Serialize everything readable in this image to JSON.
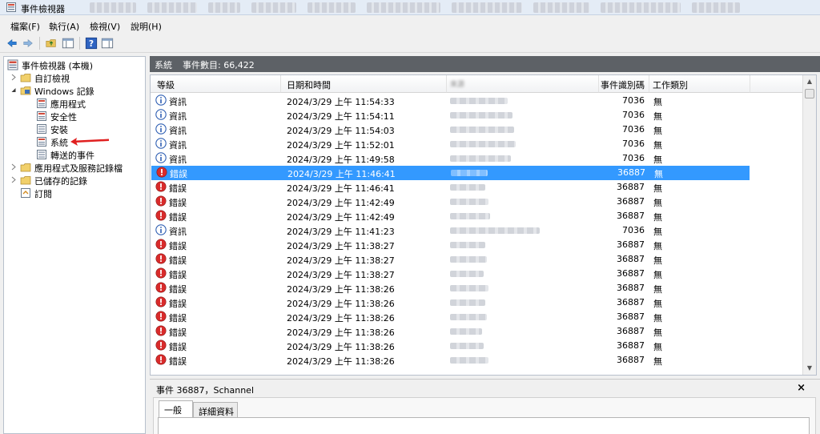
{
  "window": {
    "title": "事件檢視器"
  },
  "menu": [
    "檔案(F)",
    "執行(A)",
    "檢視(V)",
    "說明(H)"
  ],
  "tree": {
    "root": "事件檢視器 (本機)",
    "custom_views": "自訂檢視",
    "windows_logs": "Windows 記錄",
    "application": "應用程式",
    "security": "安全性",
    "setup": "安裝",
    "system": "系統",
    "forwarded": "轉送的事件",
    "app_services": "應用程式及服務記錄檔",
    "saved_logs": "已儲存的記錄",
    "subscriptions": "訂閱"
  },
  "log_header": {
    "name": "系統",
    "event_count": "事件數目: 66,422"
  },
  "columns": {
    "level": "等級",
    "datetime": "日期和時間",
    "source": "來源",
    "event_id": "事件識別碼",
    "task": "工作類別"
  },
  "rows": [
    {
      "level": "資訊",
      "type": "info",
      "datetime": "2024/3/29 上午 11:54:33",
      "event_id": "7036",
      "task": "無"
    },
    {
      "level": "資訊",
      "type": "info",
      "datetime": "2024/3/29 上午 11:54:11",
      "event_id": "7036",
      "task": "無"
    },
    {
      "level": "資訊",
      "type": "info",
      "datetime": "2024/3/29 上午 11:54:03",
      "event_id": "7036",
      "task": "無"
    },
    {
      "level": "資訊",
      "type": "info",
      "datetime": "2024/3/29 上午 11:52:01",
      "event_id": "7036",
      "task": "無"
    },
    {
      "level": "資訊",
      "type": "info",
      "datetime": "2024/3/29 上午 11:49:58",
      "event_id": "7036",
      "task": "無"
    },
    {
      "level": "錯誤",
      "type": "error",
      "datetime": "2024/3/29 上午 11:46:41",
      "event_id": "36887",
      "task": "無",
      "selected": true
    },
    {
      "level": "錯誤",
      "type": "error",
      "datetime": "2024/3/29 上午 11:46:41",
      "event_id": "36887",
      "task": "無"
    },
    {
      "level": "錯誤",
      "type": "error",
      "datetime": "2024/3/29 上午 11:42:49",
      "event_id": "36887",
      "task": "無"
    },
    {
      "level": "錯誤",
      "type": "error",
      "datetime": "2024/3/29 上午 11:42:49",
      "event_id": "36887",
      "task": "無"
    },
    {
      "level": "資訊",
      "type": "info",
      "datetime": "2024/3/29 上午 11:41:23",
      "event_id": "7036",
      "task": "無"
    },
    {
      "level": "錯誤",
      "type": "error",
      "datetime": "2024/3/29 上午 11:38:27",
      "event_id": "36887",
      "task": "無"
    },
    {
      "level": "錯誤",
      "type": "error",
      "datetime": "2024/3/29 上午 11:38:27",
      "event_id": "36887",
      "task": "無"
    },
    {
      "level": "錯誤",
      "type": "error",
      "datetime": "2024/3/29 上午 11:38:27",
      "event_id": "36887",
      "task": "無"
    },
    {
      "level": "錯誤",
      "type": "error",
      "datetime": "2024/3/29 上午 11:38:26",
      "event_id": "36887",
      "task": "無"
    },
    {
      "level": "錯誤",
      "type": "error",
      "datetime": "2024/3/29 上午 11:38:26",
      "event_id": "36887",
      "task": "無"
    },
    {
      "level": "錯誤",
      "type": "error",
      "datetime": "2024/3/29 上午 11:38:26",
      "event_id": "36887",
      "task": "無"
    },
    {
      "level": "錯誤",
      "type": "error",
      "datetime": "2024/3/29 上午 11:38:26",
      "event_id": "36887",
      "task": "無"
    },
    {
      "level": "錯誤",
      "type": "error",
      "datetime": "2024/3/29 上午 11:38:26",
      "event_id": "36887",
      "task": "無"
    },
    {
      "level": "錯誤",
      "type": "error",
      "datetime": "2024/3/29 上午 11:38:26",
      "event_id": "36887",
      "task": "無"
    }
  ],
  "detail": {
    "title": "事件 36887，Schannel",
    "tab_general": "一般",
    "tab_details": "詳細資料",
    "close": "×"
  },
  "colors": {
    "selection": "#3399ff",
    "error": "#d92b2b",
    "info": "#2f5fb3",
    "header_strip": "#5d6166",
    "annotation_arrow": "#e02020"
  }
}
